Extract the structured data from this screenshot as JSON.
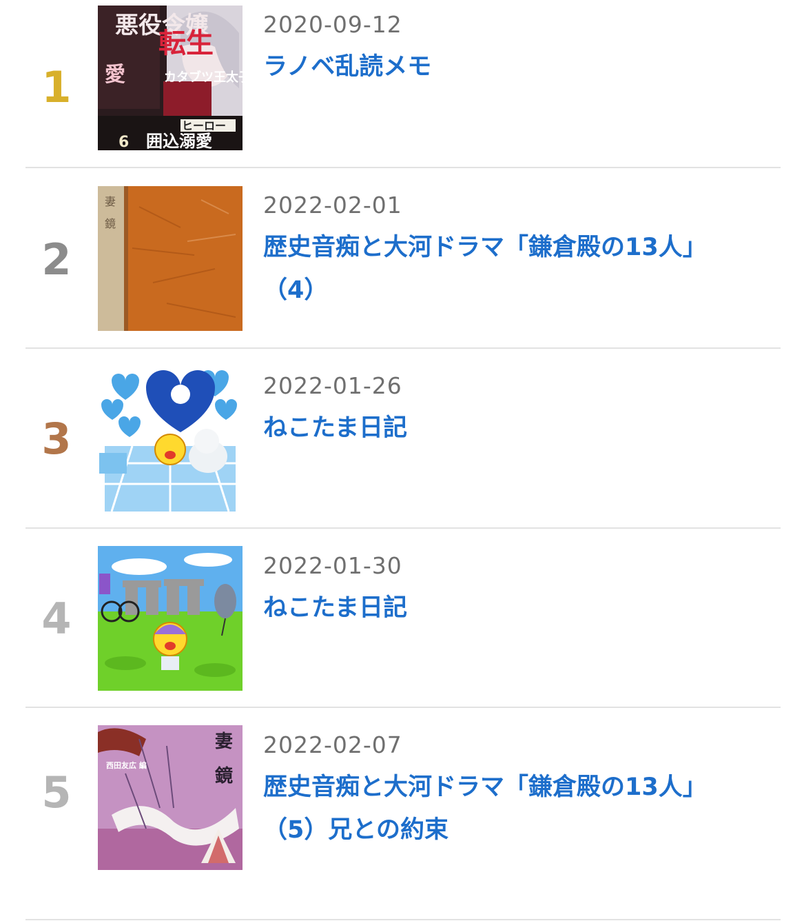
{
  "colors": {
    "link": "#1d6ecb",
    "date": "#6f6f6f",
    "divider": "#e2e2e2",
    "rank_gold": "#d8b02b",
    "rank_silver": "#8c8c8c",
    "rank_bronze": "#b2764a",
    "rank_default": "#b5b5b5"
  },
  "ranking": [
    {
      "rank": "1",
      "date": "2020-09-12",
      "title": "ラノベ乱読メモ",
      "title_line2": "",
      "thumb_icon": "light-novel-cover-thumbnail",
      "thumb_text": [
        "悪役令嬢",
        "転生",
        "カタブツ王太子",
        "愛",
        "ヒーロー",
        "6",
        "囲込溺愛"
      ]
    },
    {
      "rank": "2",
      "date": "2022-02-01",
      "title": "歴史音痴と大河ドラマ「鎌倉殿の13人」",
      "title_line2": "（4）",
      "thumb_icon": "old-book-cover-thumbnail",
      "thumb_text": []
    },
    {
      "rank": "3",
      "date": "2022-01-26",
      "title": "ねこたま日記",
      "title_line2": "",
      "thumb_icon": "hearts-tiger-scene-thumbnail",
      "thumb_text": []
    },
    {
      "rank": "4",
      "date": "2022-01-30",
      "title": "ねこたま日記",
      "title_line2": "",
      "thumb_icon": "stonehenge-scene-thumbnail",
      "thumb_text": []
    },
    {
      "rank": "5",
      "date": "2022-02-07",
      "title": "歴史音痴と大河ドラマ「鎌倉殿の13人」",
      "title_line2": "（5）兄との約束",
      "thumb_icon": "azuma-kagami-cover-thumbnail",
      "thumb_text": [
        "妻",
        "鏡",
        "西田友広 編"
      ]
    }
  ]
}
